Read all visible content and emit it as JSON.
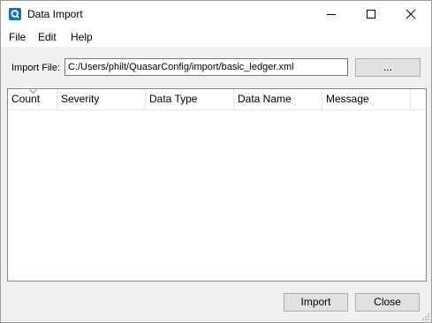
{
  "window": {
    "title": "Data Import",
    "icon": "quasar-app-icon",
    "accent": "#1a6fb4",
    "controls": [
      "minimize-icon",
      "maximize-icon",
      "close-icon"
    ]
  },
  "menu": {
    "file": "File",
    "edit": "Edit",
    "help": "Help"
  },
  "import": {
    "label": "Import File:",
    "path": "C:/Users/philt/QuasarConfig/import/basic_ledger.xml",
    "browse_label": "..."
  },
  "table": {
    "columns": [
      "Count",
      "Severity",
      "Data Type",
      "Data Name",
      "Message"
    ],
    "rows": []
  },
  "footer": {
    "import_label": "Import",
    "close_label": "Close"
  }
}
